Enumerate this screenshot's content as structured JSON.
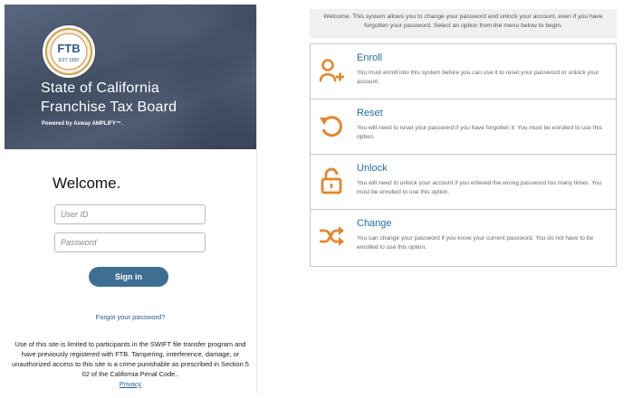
{
  "login": {
    "logo_text": "FTB",
    "logo_est": "EST 1950",
    "title_line1": "State of California",
    "title_line2": "Franchise Tax Board",
    "powered_by": "Powered by Axway AMPLIFY™.",
    "welcome": "Welcome.",
    "user_id_placeholder": "User ID",
    "password_placeholder": "Password",
    "sign_in_label": "Sign in",
    "forgot_label": "Forgot your password?",
    "disclaimer": "Use of this site is limited to participants in the SWIFT file transfer program and have previously registered with FTB. Tampering, interference, damage, or unauthorized access to this site is a crime punishable as prescribed in Section 5 02 of the California Penal Code..",
    "privacy_label": "Privacy"
  },
  "self_service": {
    "intro": "Welcome. This system allows you to change your password and unlock your account, even if you have forgotten your password. Select an option from the menu below to begin.",
    "options": [
      {
        "title": "Enroll",
        "description": "You must enroll into this system before you can use it to reset your password or unlock your account.",
        "icon": "enroll-user-plus-icon"
      },
      {
        "title": "Reset",
        "description": "You will need to reset your password if you have forgotten it. You must be enrolled to use this option.",
        "icon": "reset-circular-arrow-icon"
      },
      {
        "title": "Unlock",
        "description": "You will need to unlock your account if you entered the wrong password too many times. You must be enrolled to use this option.",
        "icon": "unlock-padlock-icon"
      },
      {
        "title": "Change",
        "description": "You can change your password if you know your current password. You do not have to be enrolled to use this option.",
        "icon": "change-shuffle-icon"
      }
    ]
  },
  "colors": {
    "accent_orange": "#e8842a",
    "link_blue": "#1e6fa3",
    "button_blue": "#3e6f93",
    "banner_slate": "#4a5870"
  }
}
